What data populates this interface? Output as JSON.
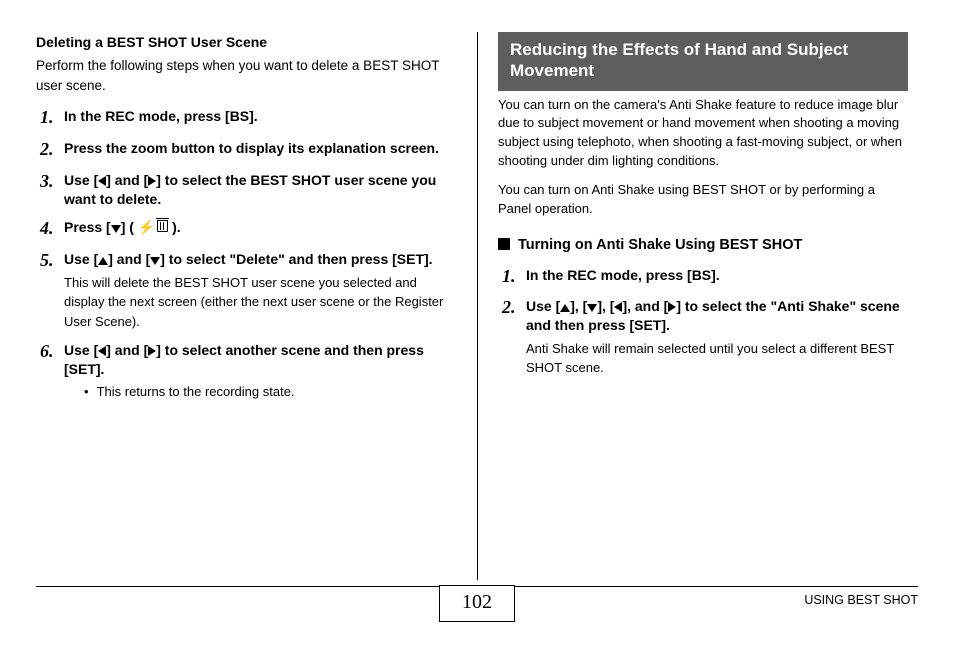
{
  "left": {
    "heading": "Deleting a BEST SHOT User Scene",
    "intro": "Perform the following steps when you want to delete a BEST SHOT user scene.",
    "steps": [
      {
        "num": "1.",
        "title": "In the REC mode, press [BS]."
      },
      {
        "num": "2.",
        "title": "Press the zoom button to display its explanation screen."
      },
      {
        "num": "3.",
        "title_pre": "Use [",
        "title_mid": "] and [",
        "title_post": "] to select the BEST SHOT user scene you want to delete."
      },
      {
        "num": "4.",
        "title_pre": "Press [",
        "title_mid": "] ( ",
        "title_post": " )."
      },
      {
        "num": "5.",
        "title_pre": "Use [",
        "title_mid": "] and [",
        "title_post": "] to select \"Delete\" and then press [SET].",
        "desc": "This will delete the BEST SHOT user scene you selected and display the next screen (either the next user scene or the Register User Scene)."
      },
      {
        "num": "6.",
        "title_pre": "Use [",
        "title_mid": "] and [",
        "title_post": "] to select another scene and then press [SET].",
        "bullet": "This returns to the recording state."
      }
    ]
  },
  "right": {
    "section_title": "Reducing the Effects of Hand and Subject Movement",
    "body1": "You can turn on the camera's Anti Shake feature to reduce image blur due to subject movement or hand movement when shooting a moving subject using telephoto, when shooting a fast-moving subject, or when shooting under dim lighting conditions.",
    "body2": "You can turn on Anti Shake using BEST SHOT or by performing a Panel operation.",
    "subsection": "Turning on Anti Shake Using BEST SHOT",
    "steps": [
      {
        "num": "1.",
        "title": "In the REC mode, press [BS]."
      },
      {
        "num": "2.",
        "title_pre": "Use [",
        "t2": "], [",
        "t3": "], [",
        "t4": "], and [",
        "title_post": "] to select the \"Anti Shake\" scene and then press [SET].",
        "desc": "Anti Shake will remain selected until you select a different BEST SHOT scene."
      }
    ]
  },
  "footer": {
    "page": "102",
    "label": "USING BEST SHOT"
  }
}
